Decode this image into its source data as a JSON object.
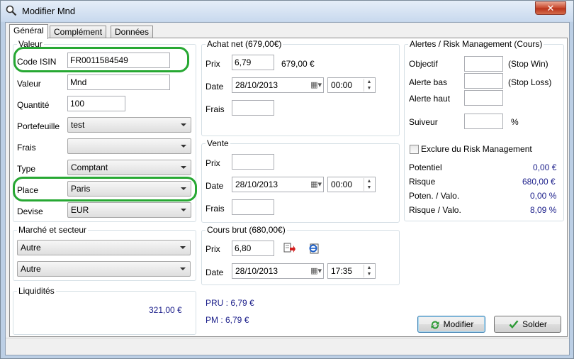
{
  "window": {
    "title": "Modifier Mnd",
    "close_label": "✕"
  },
  "tabs": [
    "Général",
    "Complément",
    "Données"
  ],
  "valeur": {
    "legend": "Valeur",
    "code_isin_label": "Code ISIN",
    "code_isin": "FR0011584549",
    "valeur_label": "Valeur",
    "valeur": "Mnd",
    "quantite_label": "Quantité",
    "quantite": "100",
    "portefeuille_label": "Portefeuille",
    "portefeuille": "test",
    "frais_label": "Frais",
    "frais": "",
    "type_label": "Type",
    "type": "Comptant",
    "place_label": "Place",
    "place": "Paris",
    "devise_label": "Devise",
    "devise": "EUR"
  },
  "marche": {
    "legend": "Marché et secteur",
    "marche": "Autre",
    "secteur": "Autre"
  },
  "liquidites": {
    "legend": "Liquidités",
    "value": "321,00 €"
  },
  "achat": {
    "legend": "Achat net (679,00€)",
    "prix_label": "Prix",
    "prix": "6,79",
    "total": "679,00 €",
    "date_label": "Date",
    "date": "28/10/2013",
    "time": "00:00",
    "frais_label": "Frais",
    "frais": ""
  },
  "vente": {
    "legend": "Vente",
    "prix_label": "Prix",
    "prix": "",
    "date_label": "Date",
    "date": "28/10/2013",
    "time": "00:00",
    "frais_label": "Frais",
    "frais": ""
  },
  "cours": {
    "legend": "Cours brut (680,00€)",
    "prix_label": "Prix",
    "prix": "6,80",
    "date_label": "Date",
    "date": "28/10/2013",
    "time": "17:35"
  },
  "pru": "PRU : 6,79 €",
  "pm": "PM : 6,79 €",
  "alertes": {
    "legend": "Alertes / Risk Management (Cours)",
    "objectif_label": "Objectif",
    "objectif_note": "(Stop Win)",
    "alerte_bas_label": "Alerte bas",
    "alerte_bas_note": "(Stop Loss)",
    "alerte_haut_label": "Alerte haut",
    "suiveur_label": "Suiveur",
    "suiveur_unit": "%",
    "exclure_label": "Exclure du Risk Management",
    "potentiel_label": "Potentiel",
    "potentiel": "0,00 €",
    "risque_label": "Risque",
    "risque": "680,00 €",
    "poten_valo_label": "Poten. / Valo.",
    "poten_valo": "0,00 %",
    "risque_valo_label": "Risque / Valo.",
    "risque_valo": "8,09 %"
  },
  "buttons": {
    "modifier": "Modifier",
    "solder": "Solder"
  },
  "colors": {
    "highlight": "#27a833",
    "value_blue": "#1b1e8a"
  }
}
